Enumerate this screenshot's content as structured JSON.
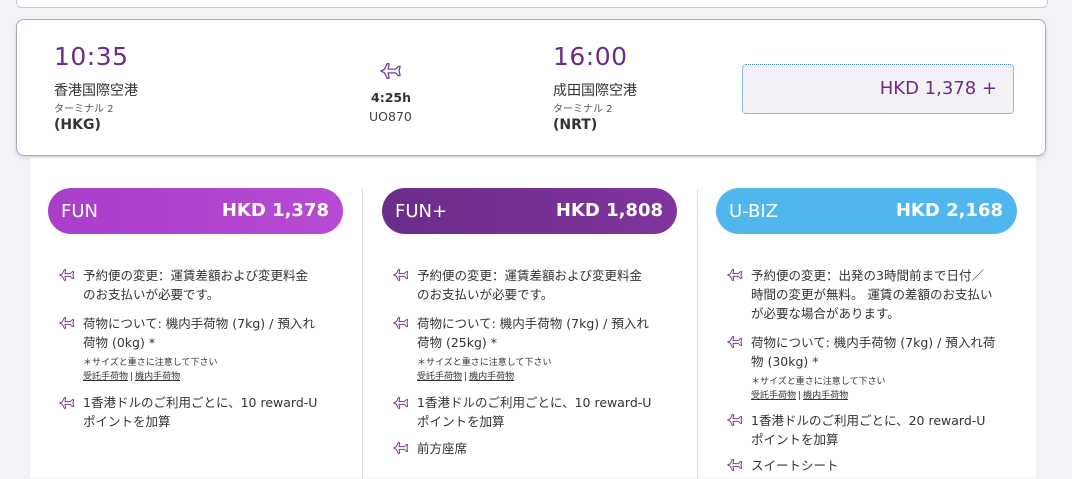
{
  "flight": {
    "departure": {
      "time": "10:35",
      "airport": "香港国際空港",
      "terminal": "ターミナル 2",
      "code": "(HKG)"
    },
    "arrival": {
      "time": "16:00",
      "airport": "成田国際空港",
      "terminal": "ターミナル 2",
      "code": "(NRT)"
    },
    "duration": "4:25h",
    "flight_number": "UO870",
    "price_button": "HKD  1,378 +"
  },
  "fares": [
    {
      "name": "FUN",
      "price": "HKD 1,378",
      "color": "#b045cf",
      "features": [
        {
          "text1": "予約便の変更：運賃差額および変更料金",
          "text2": "のお支払いが必要です。"
        },
        {
          "text1": "荷物について: 機内手荷物 (7kg) / 預入れ",
          "text2": "荷物 (0kg) *",
          "note": "＊サイズと重さに注意して下さい",
          "link1": "受託手荷物",
          "link2": "機内手荷物"
        },
        {
          "text1": "1香港ドルのご利用ごとに、10 reward-U",
          "text2": "ポイントを加算"
        }
      ]
    },
    {
      "name": "FUN+",
      "price": "HKD 1,808",
      "color": "#73308f",
      "features": [
        {
          "text1": "予約便の変更：運賃差額および変更料金",
          "text2": "のお支払いが必要です。"
        },
        {
          "text1": "荷物について: 機内手荷物 (7kg) / 預入れ",
          "text2": "荷物 (25kg) *",
          "note": "＊サイズと重さに注意して下さい",
          "link1": "受託手荷物",
          "link2": "機内手荷物"
        },
        {
          "text1": "1香港ドルのご利用ごとに、10 reward-U",
          "text2": "ポイントを加算"
        },
        {
          "text1": "前方座席"
        }
      ]
    },
    {
      "name": "U-BIZ",
      "price": "HKD 2,168",
      "color": "#4fb7ee",
      "features": [
        {
          "text1": "予約便の変更：出発の3時間前まで日付／",
          "text2": "時間の変更が無料。 運賃の差額のお支払い",
          "text3": "が必要な場合があります。"
        },
        {
          "text1": "荷物について: 機内手荷物 (7kg) / 預入れ荷",
          "text2": "物 (30kg) *",
          "note": "＊サイズと重さに注意して下さい",
          "link1": "受託手荷物",
          "link2": "機内手荷物"
        },
        {
          "text1": "1香港ドルのご利用ごとに、20 reward-U",
          "text2": "ポイントを加算"
        },
        {
          "text1": "スイートシート"
        }
      ]
    }
  ],
  "colors": {
    "purple": "#6b2c8a",
    "icon": "#7b3a96",
    "link_border": "#3b7fc4"
  },
  "icons": {
    "plane": "airplane-icon",
    "feature": "plane-bullet-icon"
  }
}
